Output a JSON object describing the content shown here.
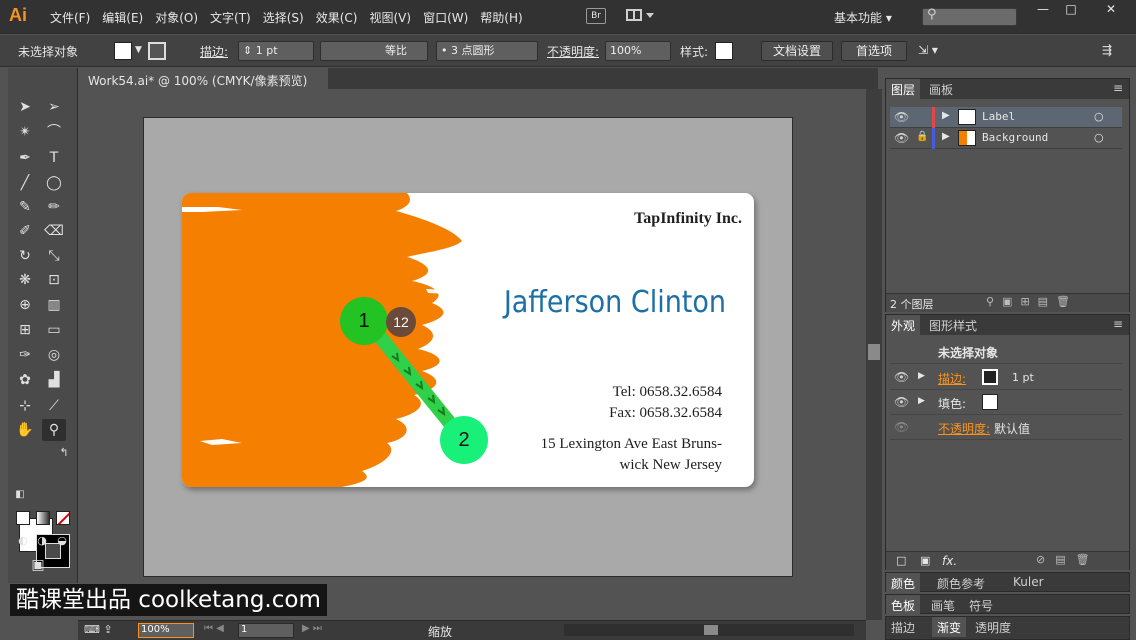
{
  "app": {
    "logo": "Ai",
    "menus": [
      "文件(F)",
      "编辑(E)",
      "对象(O)",
      "文字(T)",
      "选择(S)",
      "效果(C)",
      "视图(V)",
      "窗口(W)",
      "帮助(H)"
    ],
    "bridge": "Br",
    "workspace": "基本功能 ▾",
    "search_icon": "⚲",
    "win_buttons": [
      "—",
      "□",
      "✕"
    ]
  },
  "control": {
    "no_selection": "未选择对象",
    "stroke_label": "描边:",
    "stroke_weight": "1 pt",
    "stroke_style": "等比",
    "brush": "•  3 点圆形",
    "opacity_label": "不透明度:",
    "opacity": "100%",
    "style_label": "样式:",
    "doc_settings": "文档设置",
    "preferences": "首选项"
  },
  "document": {
    "tab": "Work54.ai* @ 100% (CMYK/像素预览)",
    "close": "✕"
  },
  "card": {
    "company": "TapInfinity Inc.",
    "name": "Jafferson Clinton",
    "tel": "Tel:  0658.32.6584",
    "fax": "Fax:  0658.32.6584",
    "address1": "15 Lexington Ave East Bruns-",
    "address2": "wick New Jersey"
  },
  "gesture": {
    "start_label": "1",
    "end_label": "2",
    "count_label": "12",
    "start_color": "#22c322",
    "end_color": "#19f07a",
    "line_color": "#2fd04a"
  },
  "status": {
    "zoom": "100%",
    "page": "1",
    "mode": "缩放"
  },
  "layers_panel": {
    "tabs": [
      "图层",
      "画板"
    ],
    "layers": [
      {
        "name": "Label",
        "color": "#e04848"
      },
      {
        "name": "Background",
        "color": "#4a5adc"
      }
    ],
    "count": "2 个图层"
  },
  "appearance_panel": {
    "tabs": [
      "外观",
      "图形样式"
    ],
    "title": "未选择对象",
    "stroke_label": "描边:",
    "stroke_value": "1 pt",
    "fill_label": "填色:",
    "opacity_label": "不透明度:",
    "opacity_value": "默认值",
    "fx": "fx."
  },
  "bottom_panels": [
    {
      "tabs": [
        "颜色",
        "颜色参考",
        "Kuler"
      ]
    },
    {
      "tabs": [
        "色板",
        "画笔",
        "符号"
      ]
    },
    {
      "tabs": [
        "描边",
        "渐变",
        "透明度"
      ]
    }
  ],
  "watermark": "酷课堂出品 coolketang.com",
  "colors": {
    "orange": "#f57f00",
    "accent": "#f7931e",
    "name_blue": "#1d6fa5"
  }
}
